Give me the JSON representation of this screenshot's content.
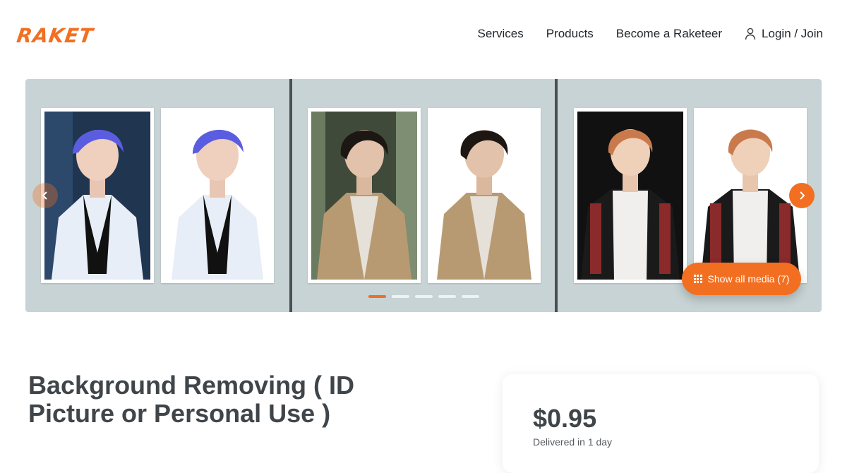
{
  "header": {
    "logo": "RAKET",
    "nav": {
      "services": "Services",
      "products": "Products",
      "become": "Become a Raketeer",
      "login": "Login / Join"
    }
  },
  "gallery": {
    "show_all_label": "Show all media (7)",
    "active_slide": 1,
    "slide_count": 5,
    "colors": {
      "accent": "#f26f21",
      "background": "#c7d3d4"
    }
  },
  "listing": {
    "title": "Background Removing ( ID Picture or Personal Use )",
    "price": "$0.95",
    "delivery": "Delivered in 1 day"
  }
}
